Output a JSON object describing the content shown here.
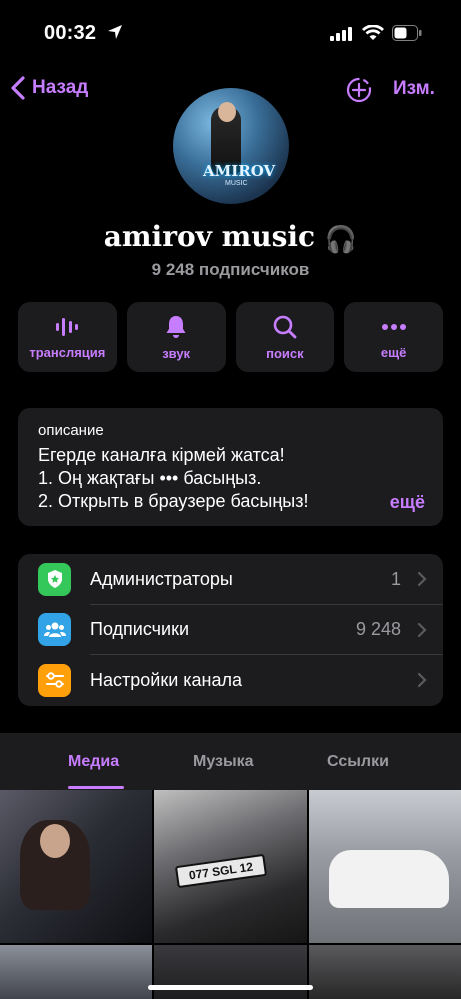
{
  "status_bar": {
    "time": "00:32"
  },
  "nav": {
    "back_label": "Назад",
    "edit_label": "Изм."
  },
  "channel": {
    "name": "amirov music",
    "emoji": "🎧",
    "subscribers": "9 248 подписчиков",
    "avatar_text": "AMIROV",
    "avatar_subtext": "MUSIC"
  },
  "actions": [
    {
      "label": "трансляция",
      "icon": "broadcast-icon"
    },
    {
      "label": "звук",
      "icon": "bell-icon"
    },
    {
      "label": "поиск",
      "icon": "search-icon"
    },
    {
      "label": "ещё",
      "icon": "more-icon"
    }
  ],
  "description": {
    "label": "описание",
    "lines": [
      "Егерде каналға кірмей жатса!",
      "1. Оң жақтағы ••• басыңыз.",
      "2. Открыть в браузере басыңыз!"
    ],
    "more_label": "ещё"
  },
  "list": [
    {
      "label": "Администраторы",
      "value": "1",
      "icon": "shield-icon",
      "color": "#34c759"
    },
    {
      "label": "Подписчики",
      "value": "9 248",
      "icon": "people-icon",
      "color": "#32a3e6"
    },
    {
      "label": "Настройки канала",
      "value": "",
      "icon": "settings-sliders-icon",
      "color": "#ff9f0a"
    }
  ],
  "tabs": [
    {
      "label": "Медиа",
      "active": true
    },
    {
      "label": "Музыка",
      "active": false
    },
    {
      "label": "Ссылки",
      "active": false
    }
  ],
  "media": {
    "plate_text": "077 SGL 12"
  },
  "colors": {
    "accent": "#c77dff",
    "background": "#000000",
    "card": "#1c1c1e",
    "secondary_text": "#9a9a9f"
  }
}
